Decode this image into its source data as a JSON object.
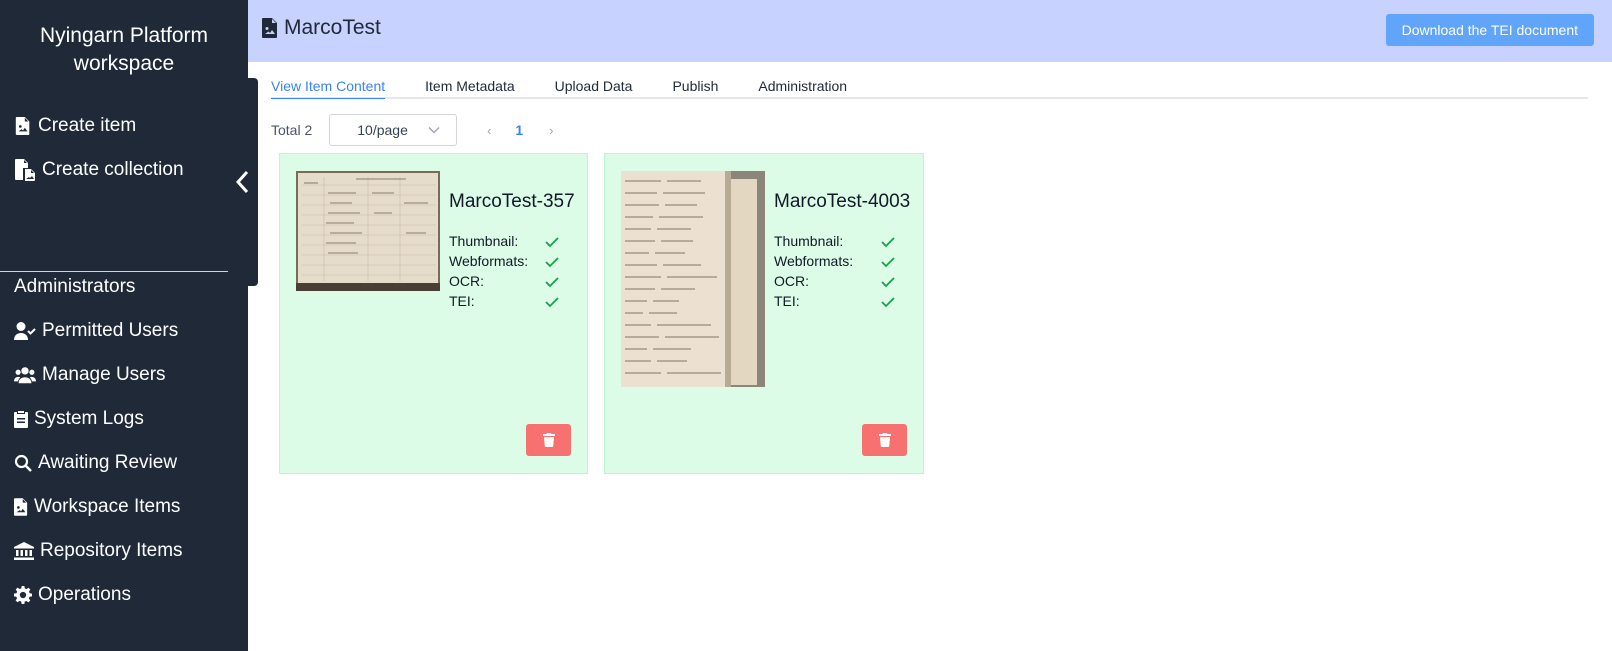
{
  "sidebar": {
    "brand_line1": "Nyingarn Platform",
    "brand_line2": "workspace",
    "create_item": "Create item",
    "create_collection": "Create collection",
    "admin_heading": "Administrators",
    "items": [
      {
        "label": "Permitted Users",
        "icon": "user-check-icon"
      },
      {
        "label": "Manage Users",
        "icon": "users-icon"
      },
      {
        "label": "System Logs",
        "icon": "clipboard-icon"
      },
      {
        "label": "Awaiting Review",
        "icon": "search-icon"
      },
      {
        "label": "Workspace Items",
        "icon": "file-image-icon"
      },
      {
        "label": "Repository Items",
        "icon": "bank-icon"
      },
      {
        "label": "Operations",
        "icon": "gear-icon"
      }
    ]
  },
  "header": {
    "title": "MarcoTest",
    "download_button": "Download the TEI document"
  },
  "tabs": [
    "View Item Content",
    "Item Metadata",
    "Upload Data",
    "Publish",
    "Administration"
  ],
  "active_tab": "View Item Content",
  "pager": {
    "total": "Total 2",
    "page_size": "10/page",
    "current_page": "1"
  },
  "status_labels": {
    "thumbnail": "Thumbnail:",
    "webformats": "Webformats:",
    "ocr": "OCR:",
    "tei": "TEI:"
  },
  "cards": [
    {
      "title": "MarcoTest-357",
      "thumbnail": true,
      "webformats": true,
      "ocr": true,
      "tei": true
    },
    {
      "title": "MarcoTest-4003",
      "thumbnail": true,
      "webformats": true,
      "ocr": true,
      "tei": true
    }
  ],
  "colors": {
    "sidebar_bg": "#1f2937",
    "header_bg": "#c7d2fe",
    "accent": "#3b82f6",
    "card_bg": "#dcfce7",
    "check": "#16a34a",
    "delete": "#f87171"
  }
}
